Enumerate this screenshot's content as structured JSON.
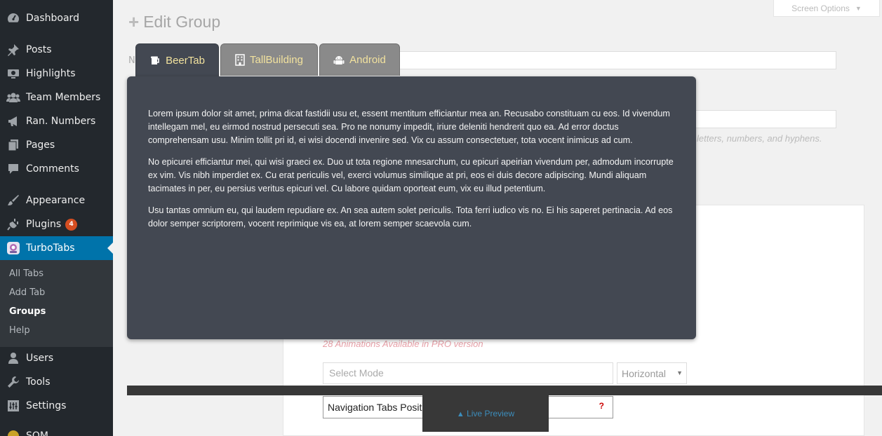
{
  "sidebar": {
    "items": [
      {
        "label": "Dashboard",
        "icon": "dashboard-icon"
      },
      {
        "label": "Posts",
        "icon": "pin-icon"
      },
      {
        "label": "Highlights",
        "icon": "screen-icon"
      },
      {
        "label": "Team Members",
        "icon": "group-icon"
      },
      {
        "label": "Ran. Numbers",
        "icon": "megaphone-icon"
      },
      {
        "label": "Pages",
        "icon": "pages-icon"
      },
      {
        "label": "Comments",
        "icon": "comment-icon"
      },
      {
        "label": "Appearance",
        "icon": "brush-icon"
      },
      {
        "label": "Plugins",
        "icon": "plug-icon",
        "badge": "4"
      },
      {
        "label": "TurboTabs",
        "icon": "turbotabs-icon"
      },
      {
        "label": "Users",
        "icon": "user-icon"
      },
      {
        "label": "Tools",
        "icon": "wrench-icon"
      },
      {
        "label": "Settings",
        "icon": "settings-icon"
      },
      {
        "label": "SOM",
        "icon": "som-icon"
      }
    ],
    "submenu": [
      "All Tabs",
      "Add Tab",
      "Groups",
      "Help"
    ]
  },
  "header": {
    "title": "Edit Group",
    "screen_options": "Screen Options"
  },
  "background_form": {
    "label_fragment": "N",
    "slug_hint": "letters, numbers, and hyphens.",
    "pro_note": "28 Animations Available in PRO version",
    "select_mode_placeholder": "Select Mode",
    "orientation_value": "Horizontal",
    "nav_position_label": "Navigation Tabs Position",
    "nav_position_help": "?",
    "partial_text": "n"
  },
  "tabs": [
    {
      "label": "BeerTab",
      "icon": "beer-icon",
      "active": true
    },
    {
      "label": "TallBuilding",
      "icon": "building-icon",
      "active": false
    },
    {
      "label": "Android",
      "icon": "android-icon",
      "active": false
    }
  ],
  "tab_content": {
    "paragraphs": [
      "Lorem ipsum dolor sit amet, prima dicat fastidii usu et, essent mentitum efficiantur mea an. Recusabo constituam cu eos. Id vivendum intellegam mel, eu eirmod nostrud persecuti sea. Pro ne nonumy impedit, iriure deleniti hendrerit quo ea. Ad error doctus comprehensam usu. Minim tollit pri id, ei wisi docendi invenire sed. Vix cu assum consectetuer, tota vocent inimicus ad cum.",
      "No epicurei efficiantur mei, qui wisi graeci ex. Duo ut tota regione mnesarchum, cu epicuri apeirian vivendum per, admodum incorrupte ex vim. Vis nibh imperdiet ex. Cu erat periculis vel, exerci volumus similique at pri, eos ei duis decore adipiscing. Mundi aliquam tacimates in per, eu persius veritus epicuri vel. Cu labore quidam oporteat eum, vix eu illud petentium.",
      "Usu tantas omnium eu, qui laudem repudiare ex. An sea autem solet periculis. Tota ferri iudico vis no. Ei his saperet pertinacia. Ad eos dolor semper scriptorem, vocent reprimique vis ea, at lorem semper scaevola cum."
    ]
  },
  "preview": {
    "label": "Live Preview",
    "icon": "chevron-up-icon"
  }
}
